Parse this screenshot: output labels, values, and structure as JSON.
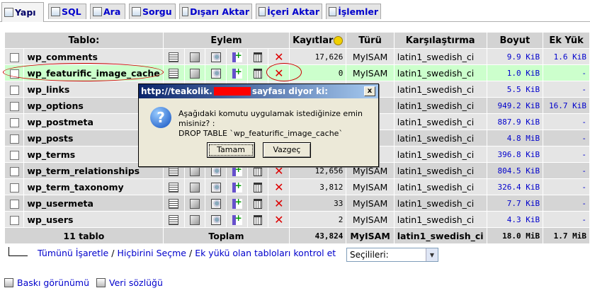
{
  "tabs": [
    {
      "label": "Yapı",
      "icon": "structure-icon",
      "active": true
    },
    {
      "label": "SQL",
      "icon": "sql-icon"
    },
    {
      "label": "Ara",
      "icon": "search-icon"
    },
    {
      "label": "Sorgu",
      "icon": "query-icon"
    },
    {
      "label": "Dışarı Aktar",
      "icon": "export-icon"
    },
    {
      "label": "İçeri Aktar",
      "icon": "import-icon"
    },
    {
      "label": "İşlemler",
      "icon": "operations-icon"
    }
  ],
  "table": {
    "headers": {
      "table": "Tablo:",
      "action": "Eylem",
      "records": "Kayıtlar",
      "type": "Türü",
      "collation": "Karşılaştırma",
      "size": "Boyut",
      "overhead": "Ek Yük"
    },
    "rows": [
      {
        "name": "wp_comments",
        "records": "17,626",
        "type": "MyISAM",
        "collation": "latin1_swedish_ci",
        "size": "9.9 KiB",
        "overhead": "1.6 KiB"
      },
      {
        "name": "wp_featurific_image_cache",
        "records": "0",
        "type": "MyISAM",
        "collation": "latin1_swedish_ci",
        "size": "1.0 KiB",
        "overhead": "-"
      },
      {
        "name": "wp_links",
        "records": "",
        "type": "",
        "collation": "latin1_swedish_ci",
        "size": "5.5 KiB",
        "overhead": "-"
      },
      {
        "name": "wp_options",
        "records": "",
        "type": "",
        "collation": "latin1_swedish_ci",
        "size": "949.2 KiB",
        "overhead": "16.7 KiB"
      },
      {
        "name": "wp_postmeta",
        "records": "",
        "type": "",
        "collation": "latin1_swedish_ci",
        "size": "887.9 KiB",
        "overhead": "-"
      },
      {
        "name": "wp_posts",
        "records": "",
        "type": "",
        "collation": "latin1_swedish_ci",
        "size": "4.8 MiB",
        "overhead": "-"
      },
      {
        "name": "wp_terms",
        "records": "",
        "type": "",
        "collation": "latin1_swedish_ci",
        "size": "396.8 KiB",
        "overhead": "-"
      },
      {
        "name": "wp_term_relationships",
        "records": "12,656",
        "type": "MyISAM",
        "collation": "latin1_swedish_ci",
        "size": "804.5 KiB",
        "overhead": "-"
      },
      {
        "name": "wp_term_taxonomy",
        "records": "3,812",
        "type": "MyISAM",
        "collation": "latin1_swedish_ci",
        "size": "326.4 KiB",
        "overhead": "-"
      },
      {
        "name": "wp_usermeta",
        "records": "33",
        "type": "MyISAM",
        "collation": "latin1_swedish_ci",
        "size": "7.7 KiB",
        "overhead": "-"
      },
      {
        "name": "wp_users",
        "records": "2",
        "type": "MyISAM",
        "collation": "latin1_swedish_ci",
        "size": "4.3 KiB",
        "overhead": "-"
      }
    ],
    "footer": {
      "count": "11 tablo",
      "total": "Toplam",
      "records": "43,824",
      "type": "MyISAM",
      "collation": "latin1_swedish_ci",
      "size": "18.0 MiB",
      "overhead": "1.7 MiB"
    }
  },
  "selection": {
    "check_all": "Tümünü İşaretle",
    "uncheck_all": "Hiçbirini Seçme",
    "check_overhead": "Ek yükü olan tabloları kontrol et",
    "separator": "/",
    "dropdown_value": "Seçilileri:"
  },
  "links": {
    "print_view": "Baskı görünümü",
    "data_dictionary": "Veri sözlüğü"
  },
  "dialog": {
    "title_prefix": "http://teakolik.",
    "title_suffix": "sayfası diyor ki:",
    "line1": "Aşağıdaki komutu uygulamak istediğinize emin misiniz? :",
    "line2": "DROP TABLE `wp_featurific_image_cache`",
    "ok": "Tamam",
    "cancel": "Vazgeç",
    "close": "x"
  },
  "colors": {
    "link": "#0000cc",
    "highlight_row": "#ccffcc",
    "annotation": "#cc0000",
    "title_bar": "#0a246a"
  }
}
